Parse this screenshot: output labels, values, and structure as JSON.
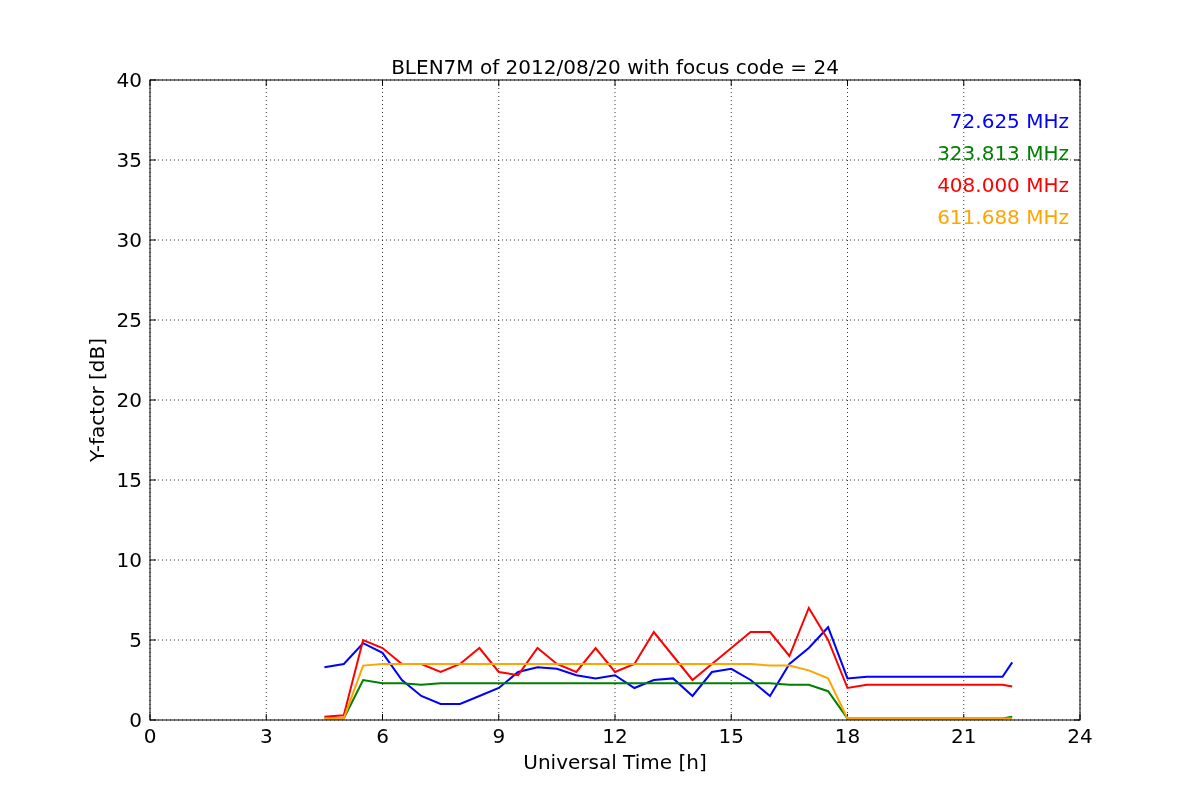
{
  "chart_data": {
    "type": "line",
    "title": "BLEN7M of 2012/08/20 with focus code = 24",
    "xlabel": "Universal Time [h]",
    "ylabel": "Y-factor [dB]",
    "x": [
      4.5,
      5,
      5.5,
      6,
      6.5,
      7,
      7.5,
      8,
      8.5,
      9,
      9.5,
      10,
      10.5,
      11,
      11.5,
      12,
      12.5,
      13,
      13.5,
      14,
      14.5,
      15,
      15.5,
      16,
      16.5,
      17,
      17.5,
      18,
      18.5,
      19,
      19.5,
      20,
      20.5,
      21,
      21.5,
      22,
      22.25
    ],
    "series": [
      {
        "name": "72.625 MHz",
        "color": "#0000ff",
        "values": [
          3.3,
          3.5,
          4.8,
          4.2,
          2.5,
          1.5,
          1.0,
          1.0,
          1.5,
          2.0,
          3.0,
          3.3,
          3.2,
          2.8,
          2.6,
          2.8,
          2.0,
          2.5,
          2.6,
          1.5,
          3.0,
          3.2,
          2.5,
          1.5,
          3.5,
          4.5,
          5.8,
          2.6,
          2.7,
          2.7,
          2.7,
          2.7,
          2.7,
          2.7,
          2.7,
          2.7,
          3.6
        ]
      },
      {
        "name": "323.813 MHz",
        "color": "#008000",
        "values": [
          0.1,
          0.1,
          2.5,
          2.3,
          2.3,
          2.2,
          2.3,
          2.3,
          2.3,
          2.3,
          2.3,
          2.3,
          2.3,
          2.3,
          2.3,
          2.3,
          2.3,
          2.3,
          2.3,
          2.3,
          2.3,
          2.3,
          2.3,
          2.3,
          2.2,
          2.2,
          1.8,
          0.1,
          0.1,
          0.1,
          0.1,
          0.1,
          0.1,
          0.1,
          0.1,
          0.1,
          0.2
        ]
      },
      {
        "name": "408.000 MHz",
        "color": "#ff0000",
        "values": [
          0.2,
          0.3,
          5.0,
          4.5,
          3.5,
          3.5,
          3.0,
          3.5,
          4.5,
          3.0,
          2.8,
          4.5,
          3.5,
          3.0,
          4.5,
          3.0,
          3.5,
          5.5,
          4.0,
          2.5,
          3.5,
          4.5,
          5.5,
          5.5,
          4.0,
          7.0,
          5.0,
          2.0,
          2.2,
          2.2,
          2.2,
          2.2,
          2.2,
          2.2,
          2.2,
          2.2,
          2.1
        ]
      },
      {
        "name": "611.688 MHz",
        "color": "#ffa500",
        "values": [
          0.1,
          0.1,
          3.4,
          3.5,
          3.5,
          3.5,
          3.5,
          3.5,
          3.5,
          3.5,
          3.5,
          3.5,
          3.5,
          3.5,
          3.5,
          3.5,
          3.5,
          3.5,
          3.5,
          3.5,
          3.5,
          3.5,
          3.5,
          3.4,
          3.4,
          3.1,
          2.6,
          0.1,
          0.1,
          0.1,
          0.1,
          0.1,
          0.1,
          0.1,
          0.1,
          0.1,
          0.1
        ]
      }
    ],
    "grid": true,
    "xlim": [
      0,
      24
    ],
    "ylim": [
      0,
      40
    ],
    "xticks": [
      0,
      3,
      6,
      9,
      12,
      15,
      18,
      21,
      24
    ],
    "yticks": [
      0,
      5,
      10,
      15,
      20,
      25,
      30,
      35,
      40
    ]
  }
}
